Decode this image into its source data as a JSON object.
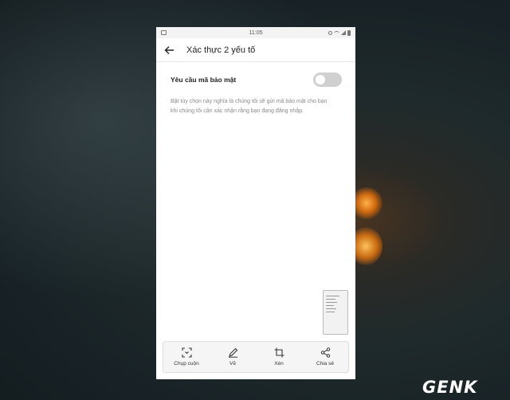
{
  "status_bar": {
    "time": "11:05"
  },
  "header": {
    "title": "Xác thực 2 yếu tố"
  },
  "setting": {
    "label": "Yêu cầu mã bảo mật",
    "enabled": false,
    "description": "Bật tùy chọn này nghĩa là chúng tôi sẽ gửi mã bảo mật cho bạn khi chúng tôi cần xác nhận rằng bạn đang đăng nhập."
  },
  "toolbar": {
    "items": [
      {
        "label": "Chụp cuộn",
        "icon": "scroll-capture-icon"
      },
      {
        "label": "Vẽ",
        "icon": "pen-icon"
      },
      {
        "label": "Xén",
        "icon": "crop-icon"
      },
      {
        "label": "Chia sẻ",
        "icon": "share-icon"
      }
    ]
  },
  "watermark": {
    "text": "GENK"
  }
}
